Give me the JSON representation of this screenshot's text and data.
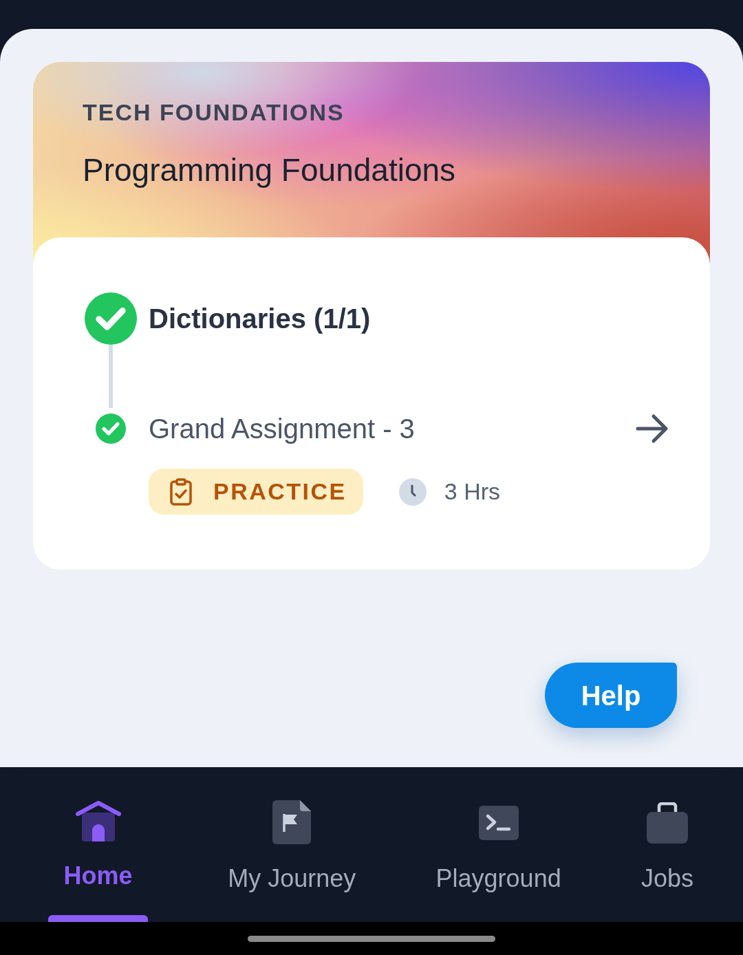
{
  "course": {
    "category": "TECH FOUNDATIONS",
    "title": "Programming Foundations"
  },
  "module": {
    "title": "Dictionaries (1/1)",
    "completed": true
  },
  "items": [
    {
      "title": "Grand Assignment - 3",
      "completed": true,
      "tag": "PRACTICE",
      "duration": "3 Hrs"
    }
  ],
  "help_button": "Help",
  "nav": [
    {
      "label": "Home",
      "selected": true
    },
    {
      "label": "My Journey",
      "selected": false
    },
    {
      "label": "Playground",
      "selected": false
    },
    {
      "label": "Jobs",
      "selected": false
    }
  ]
}
